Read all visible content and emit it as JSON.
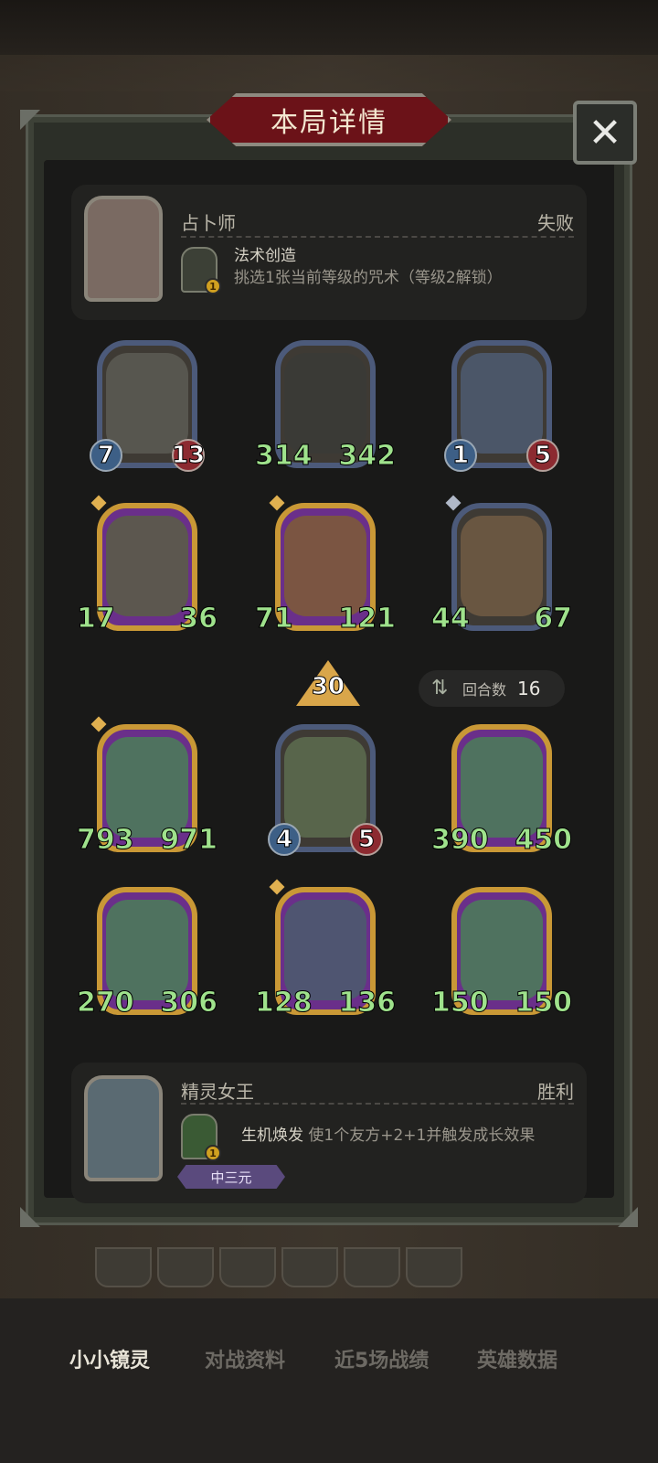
{
  "title": "本局详情",
  "close_icon": "close-x-icon",
  "top_hero": {
    "name": "占卜师",
    "result": "失败",
    "skill_name": "法术创造",
    "skill_desc": "挑选1张当前等级的咒术（等级2解锁）",
    "skill_level": "1"
  },
  "enemy_minions": [
    {
      "atk": "7",
      "hp": "13",
      "frame": "blue",
      "art": "#5a5a52"
    },
    {
      "atk": "314",
      "hp": "342",
      "frame": "blue",
      "art": "#3a3b36"
    },
    {
      "atk": "1",
      "hp": "5",
      "frame": "blue",
      "art": "#4d5a6e"
    },
    {
      "atk": "17",
      "hp": "36",
      "frame": "gold",
      "art": "#5b5c48",
      "gem": "gold"
    },
    {
      "atk": "71",
      "hp": "121",
      "frame": "gold",
      "art": "#7d5a3a",
      "gem": "gold"
    },
    {
      "atk": "44",
      "hp": "67",
      "frame": "blue",
      "art": "#6e5a42",
      "gem": "silver"
    }
  ],
  "tavern_tier": "30",
  "turns": {
    "label": "回合数",
    "value": "16",
    "icon": "swap-arrows-icon"
  },
  "player_minions": [
    {
      "atk": "793",
      "hp": "971",
      "frame": "gold",
      "art": "#4d7a5a",
      "gem": "gold"
    },
    {
      "atk": "4",
      "hp": "5",
      "frame": "blue",
      "art": "#5b6a4e"
    },
    {
      "atk": "390",
      "hp": "450",
      "frame": "gold",
      "art": "#4d7a5a"
    },
    {
      "atk": "270",
      "hp": "306",
      "frame": "gold",
      "art": "#4d7a5a"
    },
    {
      "atk": "128",
      "hp": "136",
      "frame": "gold",
      "art": "#4d5a6e",
      "gem": "gold"
    },
    {
      "atk": "150",
      "hp": "150",
      "frame": "gold",
      "art": "#4d7a5a"
    }
  ],
  "bottom_hero": {
    "name": "精灵女王",
    "result": "胜利",
    "skill_name": "生机焕发",
    "skill_desc": "使1个友方+2+1并触发成长效果",
    "skill_level": "1",
    "tag": "中三元"
  },
  "tabs": [
    "小小镜灵",
    "对战资料",
    "近5场战绩",
    "英雄数据"
  ]
}
